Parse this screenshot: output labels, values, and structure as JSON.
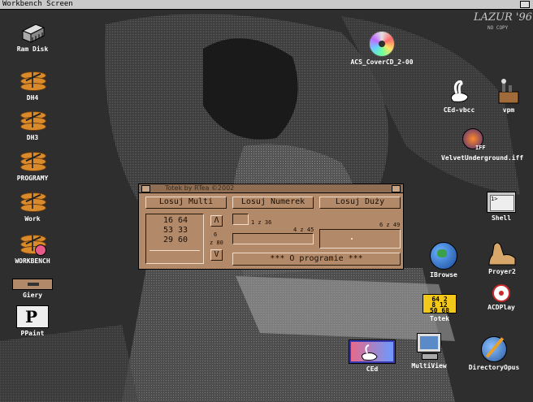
{
  "screen": {
    "title": "Workbench Screen",
    "watermark": "LAZUR '96",
    "watermark_sub": "NO COPY"
  },
  "left_icons": [
    {
      "label": "Ram Disk"
    },
    {
      "label": "DH4"
    },
    {
      "label": "DH3"
    },
    {
      "label": "PROGRAMY"
    },
    {
      "label": "Work"
    },
    {
      "label": "WORKBENCH"
    },
    {
      "label": "Giery"
    },
    {
      "label": "PPaint"
    }
  ],
  "right_icons": [
    {
      "label": "ACS_CoverCD_2-00"
    },
    {
      "label": "CEd-vbcc"
    },
    {
      "label": "vpm"
    },
    {
      "label": "VelvetUnderground.iff",
      "badge": "IFF"
    },
    {
      "label": "Shell"
    },
    {
      "label": "IBrowse"
    },
    {
      "label": "Proyer2"
    },
    {
      "label": "Totek"
    },
    {
      "label": "ACDPlay"
    },
    {
      "label": "CEd"
    },
    {
      "label": "MultiView"
    },
    {
      "label": "DirectoryOpus"
    }
  ],
  "totek_icon_numbers": [
    "64",
    "2",
    "8",
    "12",
    "50",
    "68"
  ],
  "window": {
    "title": "Totek by RTea ©2002",
    "buttons": {
      "multi": "Losuj Multi",
      "numerek": "Losuj Numerek",
      "duzy": "Losuj Duży",
      "about": "*** O programie ***"
    },
    "results": [
      "16 64",
      "53 33",
      "29 60"
    ],
    "stepper_up": "Λ",
    "stepper_down": "V",
    "stepper_value": "6",
    "stepper_caption": "z 80",
    "label_1z36": "1 z 36",
    "label_4z45": "4 z 45",
    "label_6z49": "6 z 49"
  }
}
